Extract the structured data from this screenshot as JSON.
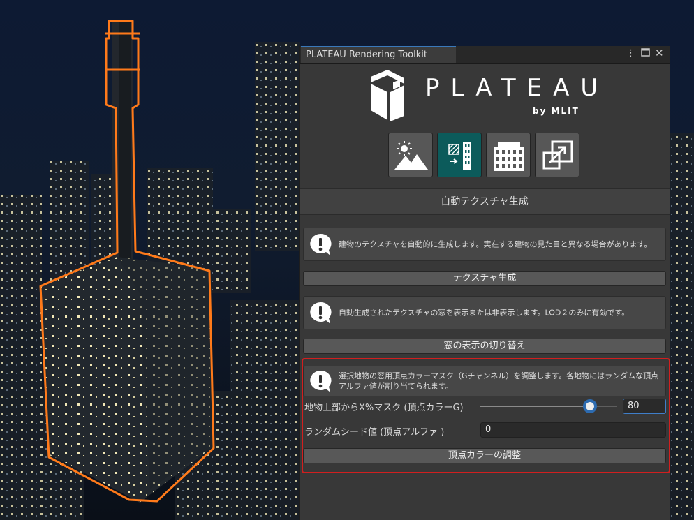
{
  "window": {
    "tab_title": "PLATEAU Rendering Toolkit",
    "menu_icon": "kebab-menu-icon",
    "maximize_icon": "maximize-icon",
    "close_icon": "close-icon"
  },
  "logo": {
    "word": "PLATEAU",
    "sub": "by MLIT"
  },
  "modes": [
    {
      "icon": "environment-icon",
      "active": false
    },
    {
      "icon": "auto-texture-icon",
      "active": true
    },
    {
      "icon": "building-icon",
      "active": false
    },
    {
      "icon": "export-icon",
      "active": false
    }
  ],
  "section_title": "自動テクスチャ生成",
  "help": [
    "建物のテクスチャを自動的に生成します。実在する建物の見た目と異なる場合があります。",
    "自動生成されたテクスチャの窓を表示または非表示します。LOD２のみに有効です。",
    "選択地物の窓用頂点カラーマスク（Gチャンネル）を調整します。各地物にはランダムな頂点アルファ値が割り当てられます。"
  ],
  "buttons": {
    "generate": "テクスチャ生成",
    "toggle_windows": "窓の表示の切り替え",
    "adjust_vertex_color": "頂点カラーの調整"
  },
  "mask_slider": {
    "label": "地物上部からX%マスク (頂点カラーG)",
    "value": "80",
    "min": 0,
    "max": 100
  },
  "random_seed": {
    "label": "ランダムシード値 (頂点アルファ )",
    "value": "0"
  },
  "colors": {
    "accent": "#3a79bb",
    "active_mode": "#0c5b5b",
    "highlight": "#d11f1f",
    "selection": "#ff7a1a"
  }
}
